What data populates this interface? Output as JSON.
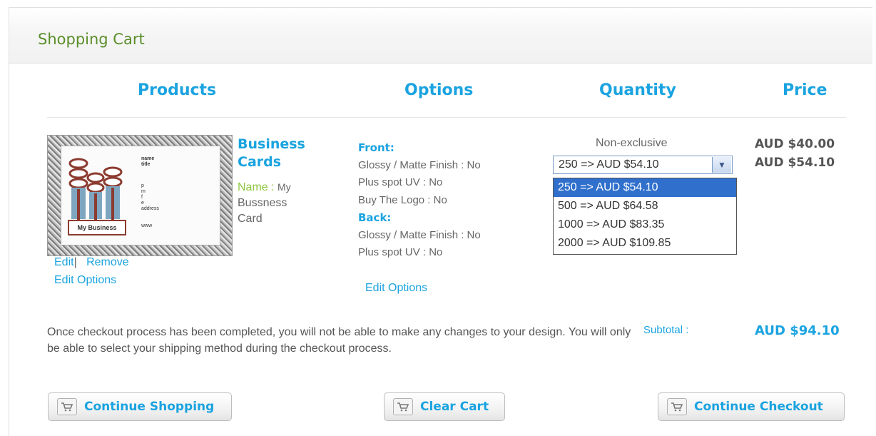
{
  "header": {
    "title": "Shopping Cart"
  },
  "columns": {
    "products": "Products",
    "options": "Options",
    "quantity": "Quantity",
    "price": "Price"
  },
  "product": {
    "name_line1": "Business",
    "name_line2": "Cards",
    "name_label": "Name :",
    "name_value_1": "My",
    "name_value_2": "Bussness",
    "name_value_3": "Card",
    "thumbnail_text": {
      "business": "My Business",
      "name": "name",
      "title": "title",
      "p": "p",
      "m": "m",
      "f": "f",
      "e": "e",
      "address": "address",
      "www": "www"
    },
    "edit": "Edit",
    "separator": "|",
    "remove": "Remove",
    "edit_options": "Edit Options"
  },
  "options": {
    "front_label": "Front:",
    "front_lines": [
      "Glossy / Matte Finish : No",
      "Plus spot UV : No",
      "Buy The Logo : No"
    ],
    "back_label": "Back:",
    "back_lines": [
      "Glossy / Matte Finish : No",
      "Plus spot UV : No"
    ],
    "edit_options": "Edit Options"
  },
  "quantity": {
    "type": "Non-exclusive",
    "selected": "250 => AUD $54.10",
    "options": [
      "250 => AUD $54.10",
      "500 => AUD $64.58",
      "1000 => AUD $83.35",
      "2000 => AUD $109.85"
    ]
  },
  "prices": [
    "AUD $40.00",
    "AUD $54.10"
  ],
  "note": "Once checkout process has been completed, you will not be able to make any changes to your design. You will only be able to select your shipping method during the checkout process.",
  "subtotal": {
    "label": "Subtotal :",
    "value": "AUD $94.10"
  },
  "buttons": {
    "continue_shopping": "Continue Shopping",
    "clear_cart": "Clear Cart",
    "continue_checkout": "Continue Checkout"
  },
  "colors": {
    "accent": "#1aa3e0",
    "title_green": "#5b8e2a",
    "label_green": "#8dc63f",
    "selected_bg": "#3070cc"
  },
  "icons": {
    "cart": "cart-icon",
    "dropdown": "chevron-down-icon"
  }
}
